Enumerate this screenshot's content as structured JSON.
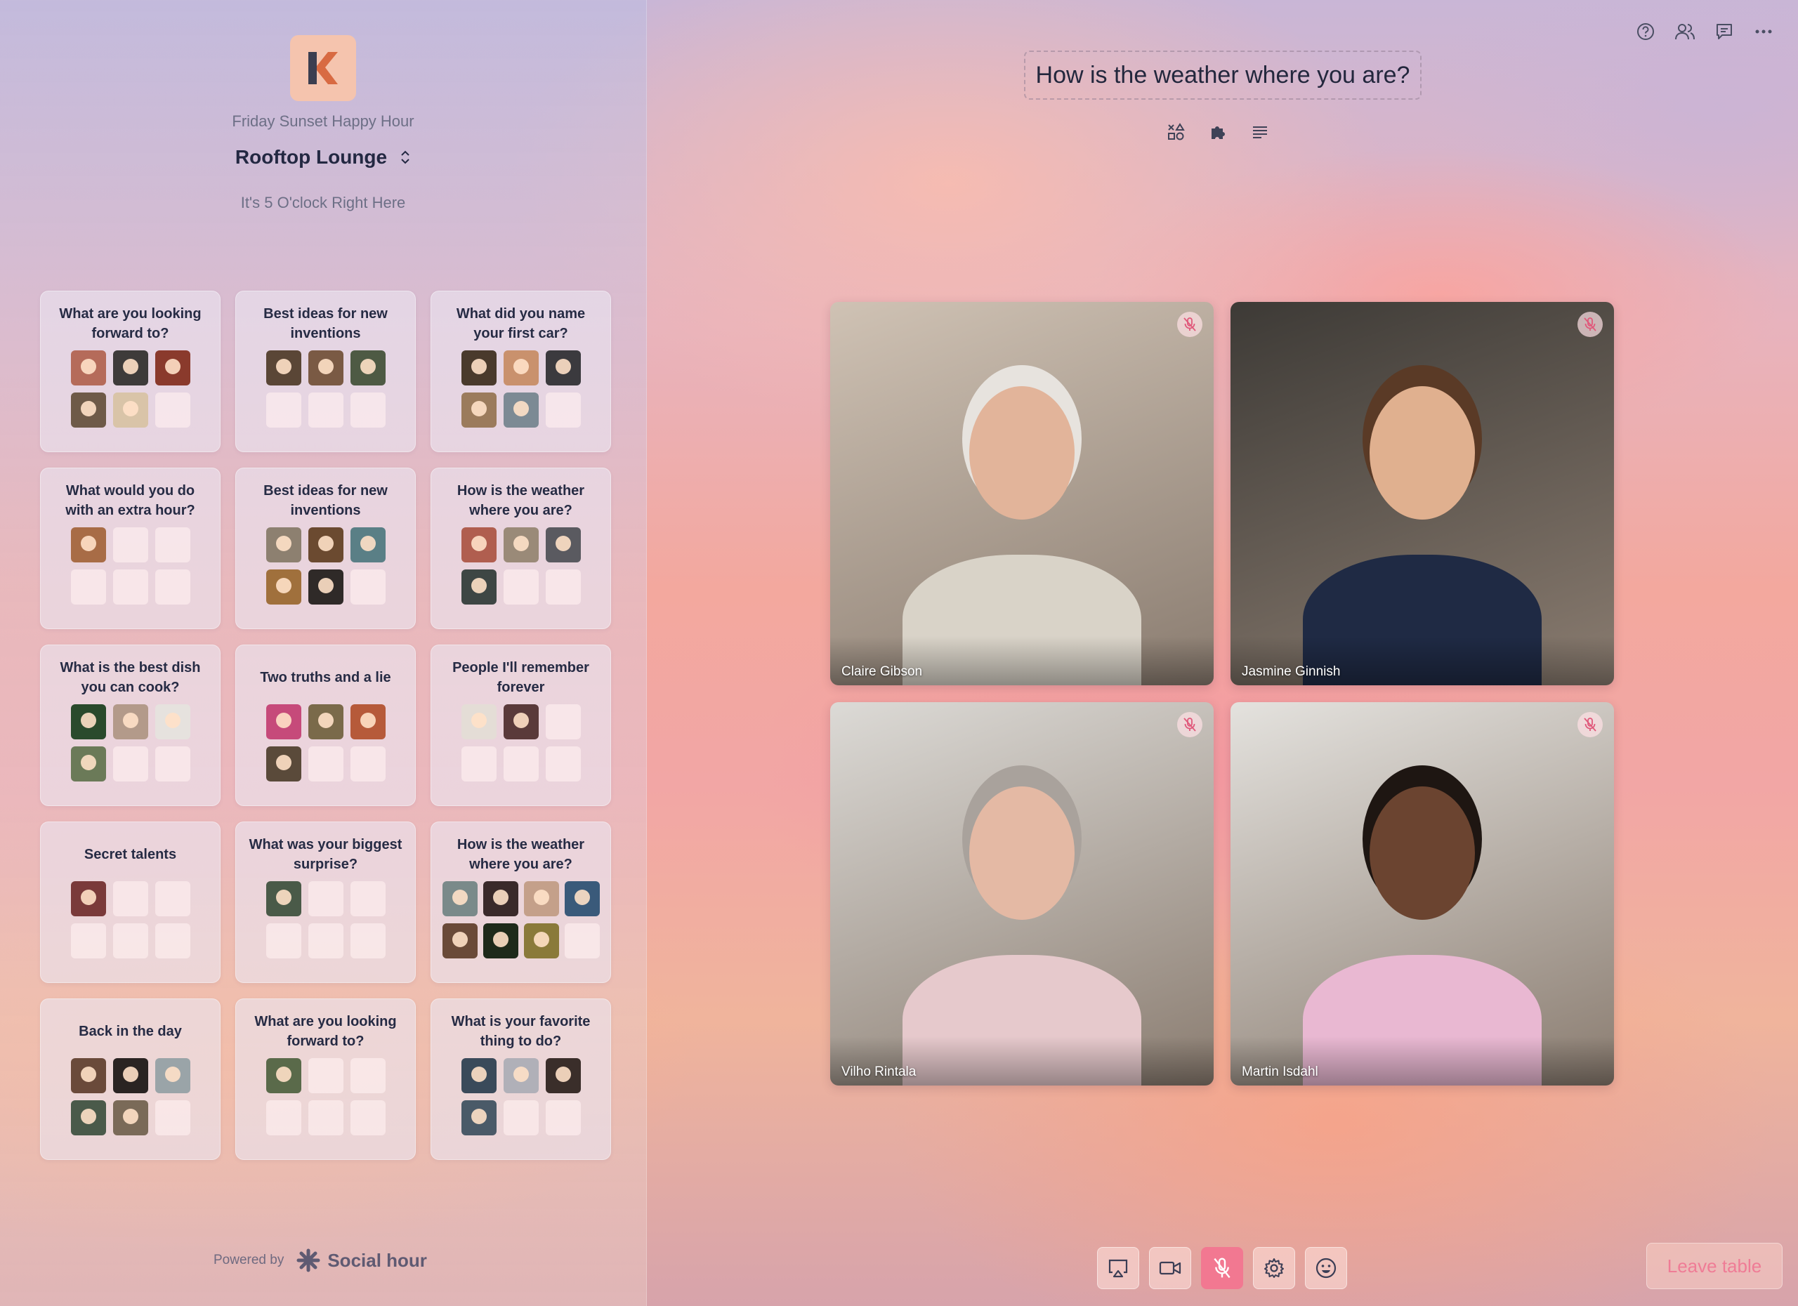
{
  "event": {
    "name": "Friday Sunset Happy Hour",
    "room": "Rooftop Lounge",
    "tagline": "It's 5 O'clock Right Here",
    "logo_letter": "K"
  },
  "tables": [
    {
      "title": "What are you looking forward to?",
      "seats": 6,
      "participants": [
        "#b56b5a",
        "#3e3b3a",
        "#8a3a2c",
        "#6e5a48",
        "#d9c4a8"
      ]
    },
    {
      "title": "Best ideas for new inventions",
      "seats": 6,
      "participants": [
        "#5a4636",
        "#7a5a44",
        "#4e5a44"
      ]
    },
    {
      "title": "What did you name your first car?",
      "seats": 6,
      "participants": [
        "#4a3a2c",
        "#c9916d",
        "#3b3a3e",
        "#9b7b5c",
        "#7c8a94"
      ]
    },
    {
      "title": "What would you do with an extra hour?",
      "seats": 6,
      "participants": [
        "#a86c46"
      ]
    },
    {
      "title": "Best ideas for new inventions",
      "seats": 6,
      "participants": [
        "#8d8070",
        "#6b4a30",
        "#5a7f86",
        "#a0703c",
        "#2f2a28"
      ]
    },
    {
      "title": "How is the weather where you are?",
      "seats": 6,
      "participants": [
        "#b05e4f",
        "#9a8a78",
        "#5a5a60",
        "#3e4644"
      ]
    },
    {
      "title": "What is the best dish you can cook?",
      "seats": 6,
      "participants": [
        "#2a4a2c",
        "#b39a8a",
        "#e6e2de",
        "#6b7a58"
      ]
    },
    {
      "title": "Two truths and a lie",
      "seats": 6,
      "participants": [
        "#c64a7a",
        "#7a6a4a",
        "#b65a3a",
        "#5a4a3a"
      ]
    },
    {
      "title": "People I'll remember forever",
      "seats": 6,
      "participants": [
        "#e4ddd6",
        "#5a3a3a"
      ]
    },
    {
      "title": "Secret talents",
      "seats": 6,
      "participants": [
        "#7a3a3a"
      ]
    },
    {
      "title": "What was your biggest surprise?",
      "seats": 6,
      "participants": [
        "#4a5a48"
      ]
    },
    {
      "title": "How is the weather where you are?",
      "seats": 8,
      "participants": [
        "#7a8a8a",
        "#3a2a2a",
        "#c4a08a",
        "#3a5a7a",
        "#6a4a38",
        "#1e2a1a",
        "#8a7a3a"
      ]
    },
    {
      "title": "Back in the day",
      "seats": 6,
      "participants": [
        "#6a4a3a",
        "#2a2422",
        "#9aa4a8",
        "#4a5a4a",
        "#7a6a58"
      ]
    },
    {
      "title": "What are you looking forward to?",
      "seats": 6,
      "participants": [
        "#5a6a4a"
      ]
    },
    {
      "title": "What is your favorite thing to do?",
      "seats": 6,
      "participants": [
        "#3a4a5a",
        "#b0b0b8",
        "#3a2e2a",
        "#4a5a68"
      ]
    }
  ],
  "footer": {
    "powered_by": "Powered by",
    "brand": "Social hour"
  },
  "header_icons": [
    "help-icon",
    "people-icon",
    "chat-icon",
    "more-icon"
  ],
  "question": "How is the weather where you are?",
  "question_tools": [
    "shapes-icon",
    "puzzle-icon",
    "list-icon"
  ],
  "participants": [
    {
      "name": "Claire Gibson",
      "muted": true,
      "bg": "#cfc2b4",
      "skin": "#e2b49a",
      "hair": "#e7e3de",
      "shirt": "#d9d3c8"
    },
    {
      "name": "Jasmine Ginnish",
      "muted": true,
      "bg": "#3d3a36",
      "skin": "#e0b08f",
      "hair": "#5a3a26",
      "shirt": "#1f2a44"
    },
    {
      "name": "Vilho Rintala",
      "muted": true,
      "bg": "#dcdad6",
      "skin": "#e4b9a4",
      "hair": "#a9a29c",
      "shirt": "#e6c9cc"
    },
    {
      "name": "Martin Isdahl",
      "muted": true,
      "bg": "#e4e2de",
      "skin": "#6b4430",
      "hair": "#1e1612",
      "shirt": "#e9b8d2"
    }
  ],
  "controls": [
    {
      "name": "screen-share-button",
      "icon": "airplay-icon",
      "active": false
    },
    {
      "name": "camera-button",
      "icon": "video-icon",
      "active": false
    },
    {
      "name": "mic-button",
      "icon": "mic-off-icon",
      "active": true
    },
    {
      "name": "settings-button",
      "icon": "gear-icon",
      "active": false
    },
    {
      "name": "emoji-button",
      "icon": "smile-icon",
      "active": false
    }
  ],
  "leave_label": "Leave table",
  "colors": {
    "accent": "#f27891",
    "logo_bg": "#f5c4ae",
    "logo_k": "#d86a42"
  }
}
